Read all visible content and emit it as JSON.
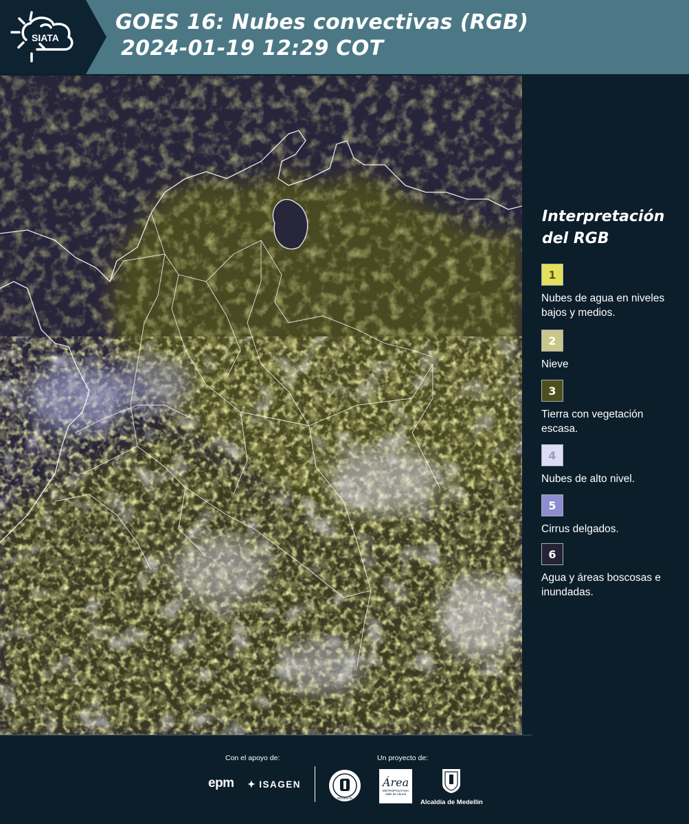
{
  "header": {
    "logo_text": "SIATA",
    "title_line1": "GOES 16: Nubes convectivas (RGB)",
    "title_line2": "2024-01-19 12:29 COT"
  },
  "legend": {
    "title_line1": "Interpretación",
    "title_line2": "del RGB",
    "items": [
      {
        "num": "1",
        "label": "Nubes de agua en niveles bajos y medios.",
        "color": "#e3e05c",
        "text_color": "#5a5820"
      },
      {
        "num": "2",
        "label": "Nieve",
        "color": "#c8c688",
        "text_color": "#ffffff"
      },
      {
        "num": "3",
        "label": "Tierra con vegetación escasa.",
        "color": "#4f4f1c",
        "text_color": "#ffffff"
      },
      {
        "num": "4",
        "label": "Nubes de alto nivel.",
        "color": "#dcdcf4",
        "text_color": "#9a9ac0"
      },
      {
        "num": "5",
        "label": "Cirrus delgados.",
        "color": "#8d8dd0",
        "text_color": "#ffffff"
      },
      {
        "num": "6",
        "label": "Agua y áreas boscosas e inundadas.",
        "color": "#252235",
        "text_color": "#ffffff"
      }
    ]
  },
  "footer": {
    "support_label": "Con el apoyo de:",
    "project_label": "Un proyecto de:",
    "sponsor1": "epm",
    "sponsor2": "ISAGEN",
    "seal_text": "MEDELLÍN",
    "area_name": "Área",
    "area_sub": "METROPOLITANA Valle de Aburrá",
    "alcaldia": "Alcaldía de Medellín"
  }
}
